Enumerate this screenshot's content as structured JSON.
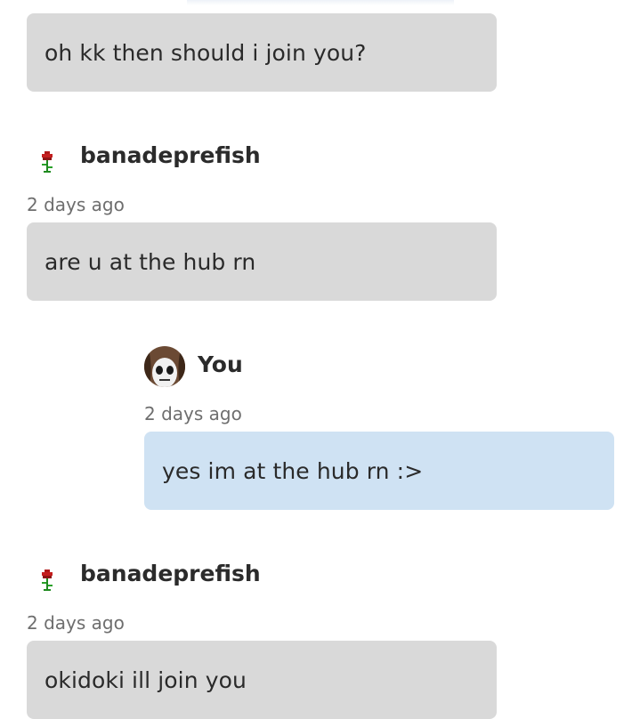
{
  "messages": [
    {
      "text": "oh kk then should i join you?"
    },
    {
      "author": "banadeprefish",
      "time": "2 days ago",
      "text": "are u at the hub rn"
    },
    {
      "author": "You",
      "time": "2 days ago",
      "text": "yes im at the hub rn :>"
    },
    {
      "author": "banadeprefish",
      "time": "2 days ago",
      "text": "okidoki ill join you"
    }
  ],
  "colors": {
    "them_bubble": "#d9d9d9",
    "me_bubble": "#cfe2f3"
  },
  "icons": {
    "them_avatar": "rose-icon",
    "me_avatar": "skull-avatar"
  }
}
